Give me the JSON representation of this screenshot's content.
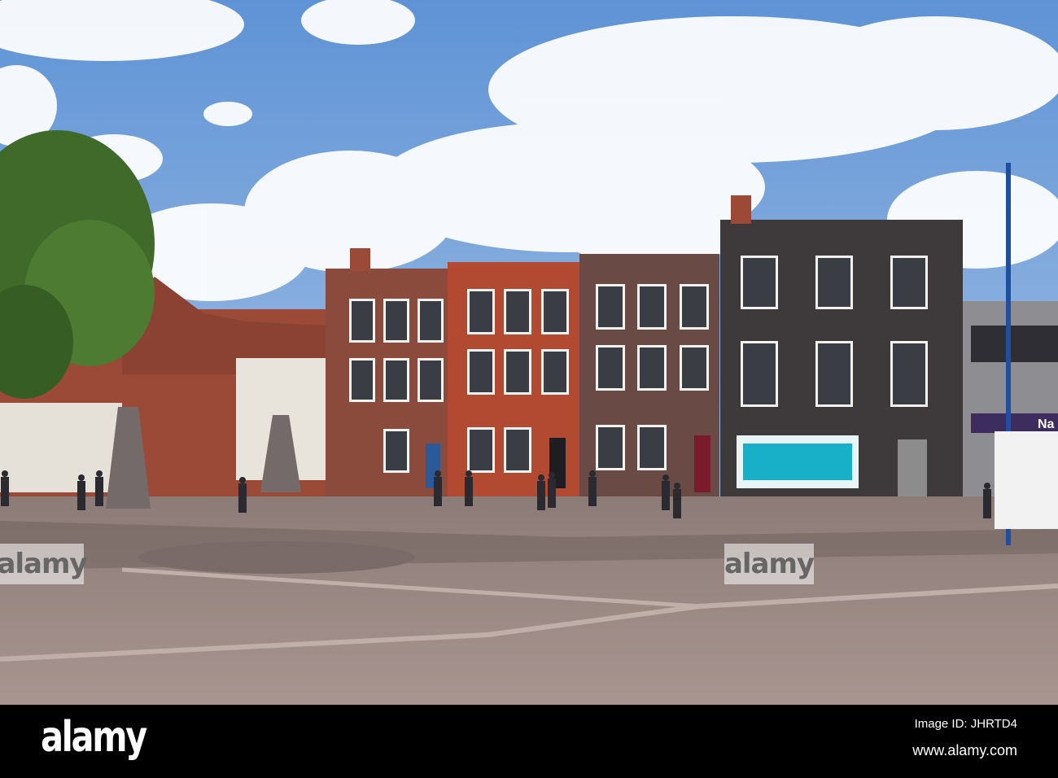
{
  "photo": {
    "watermark_text": "alamy",
    "sky_color": "#6f9fd8",
    "pavement_color": "#9e8d86",
    "brick_red": "#a64a32",
    "brick_dark": "#4a3a36"
  },
  "signs": {
    "bank_partial": "Na"
  },
  "footer": {
    "logo": "alamy",
    "image_id": "Image ID: JHRTD4",
    "url": "www.alamy.com"
  }
}
